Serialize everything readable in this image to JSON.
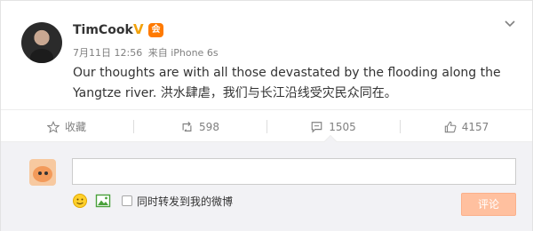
{
  "post": {
    "author": "TimCook",
    "verified_mark": "V",
    "member_badge": "会",
    "date": "7月11日 12:56",
    "source": "来自 iPhone 6s",
    "text": "Our thoughts are with all those devastated by the flooding along the Yangtze river. 洪水肆虐，我们与长江沿线受灾民众同在。"
  },
  "actions": {
    "favorite": {
      "label": "收藏",
      "icon": "star-icon"
    },
    "repost": {
      "count": "598",
      "icon": "repost-icon"
    },
    "comment": {
      "count": "1505",
      "icon": "comment-icon"
    },
    "like": {
      "count": "4157",
      "icon": "thumbs-up-icon"
    }
  },
  "comment_box": {
    "input_value": "",
    "repost_checkbox_label": "同时转发到我的微博",
    "submit_label": "评论"
  },
  "colors": {
    "accent_orange": "#ff8140",
    "submit_disabled": "#ffc09f",
    "verified": "#f2a20b",
    "comment_bg": "#f2f2f5"
  }
}
